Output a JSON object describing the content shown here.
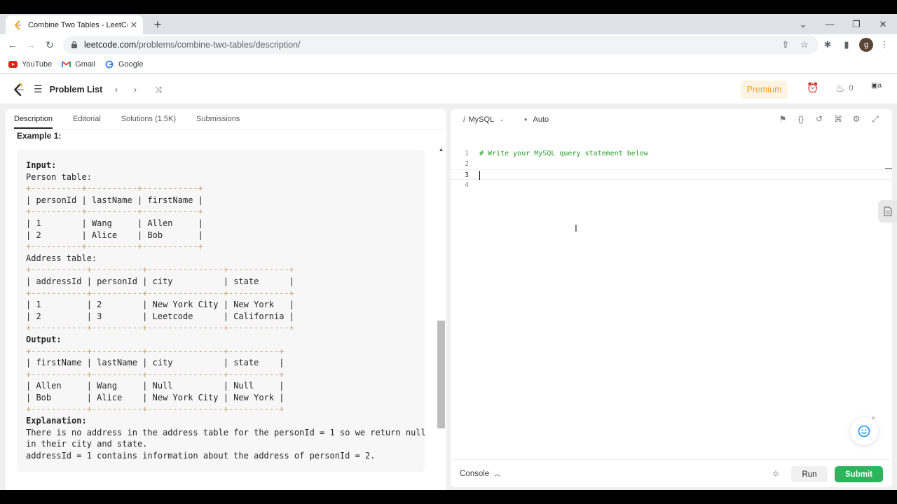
{
  "browser": {
    "tab_title": "Combine Two Tables - LeetCode",
    "url_host": "leetcode.com",
    "url_path": "/problems/combine-two-tables/description/",
    "profile_initial": "g",
    "bookmarks": [
      {
        "label": "YouTube",
        "icon": "youtube-icon"
      },
      {
        "label": "Gmail",
        "icon": "gmail-icon"
      },
      {
        "label": "Google",
        "icon": "google-icon"
      }
    ]
  },
  "nav": {
    "problem_list": "Problem List",
    "premium": "Premium",
    "streak_count": "0",
    "avatar_alt": "a"
  },
  "left": {
    "tabs": [
      "Description",
      "Editorial",
      "Solutions (1.5K)",
      "Submissions"
    ],
    "example_heading": "Example 1:",
    "lines": [
      {
        "t": "Input:",
        "b": true
      },
      {
        "t": "Person table:"
      },
      {
        "t": "+----------+----------+-----------+",
        "tl": true
      },
      {
        "t": "| personId | lastName | firstName |",
        "tl": false
      },
      {
        "t": "+----------+----------+-----------+",
        "tl": true
      },
      {
        "t": "| 1        | Wang     | Allen     |"
      },
      {
        "t": "| 2        | Alice    | Bob       |"
      },
      {
        "t": "+----------+----------+-----------+",
        "tl": true
      },
      {
        "t": "Address table:"
      },
      {
        "t": "+-----------+----------+---------------+------------+",
        "tl": true
      },
      {
        "t": "| addressId | personId | city          | state      |"
      },
      {
        "t": "+-----------+----------+---------------+------------+",
        "tl": true
      },
      {
        "t": "| 1         | 2        | New York City | New York   |"
      },
      {
        "t": "| 2         | 3        | Leetcode      | California |"
      },
      {
        "t": "+-----------+----------+---------------+------------+",
        "tl": true
      },
      {
        "t": "Output:",
        "b": true
      },
      {
        "t": "+-----------+----------+---------------+----------+",
        "tl": true
      },
      {
        "t": "| firstName | lastName | city          | state    |"
      },
      {
        "t": "+-----------+----------+---------------+----------+",
        "tl": true
      },
      {
        "t": "| Allen     | Wang     | Null          | Null     |"
      },
      {
        "t": "| Bob       | Alice    | New York City | New York |"
      },
      {
        "t": "+-----------+----------+---------------+----------+",
        "tl": true
      },
      {
        "t": "Explanation:",
        "b": true
      },
      {
        "t": "There is no address in the address table for the personId = 1 so we return null"
      },
      {
        "t": "in their city and state."
      },
      {
        "t": "addressId = 1 contains information about the address of personId = 2."
      }
    ]
  },
  "editor": {
    "language": "MySQL",
    "mode": "Auto",
    "lines": [
      {
        "n": "1",
        "t": "# Write your MySQL query statement below"
      },
      {
        "n": "2",
        "t": ""
      },
      {
        "n": "3",
        "t": ""
      },
      {
        "n": "4",
        "t": ""
      }
    ]
  },
  "console": {
    "label": "Console",
    "run": "Run",
    "submit": "Submit"
  }
}
